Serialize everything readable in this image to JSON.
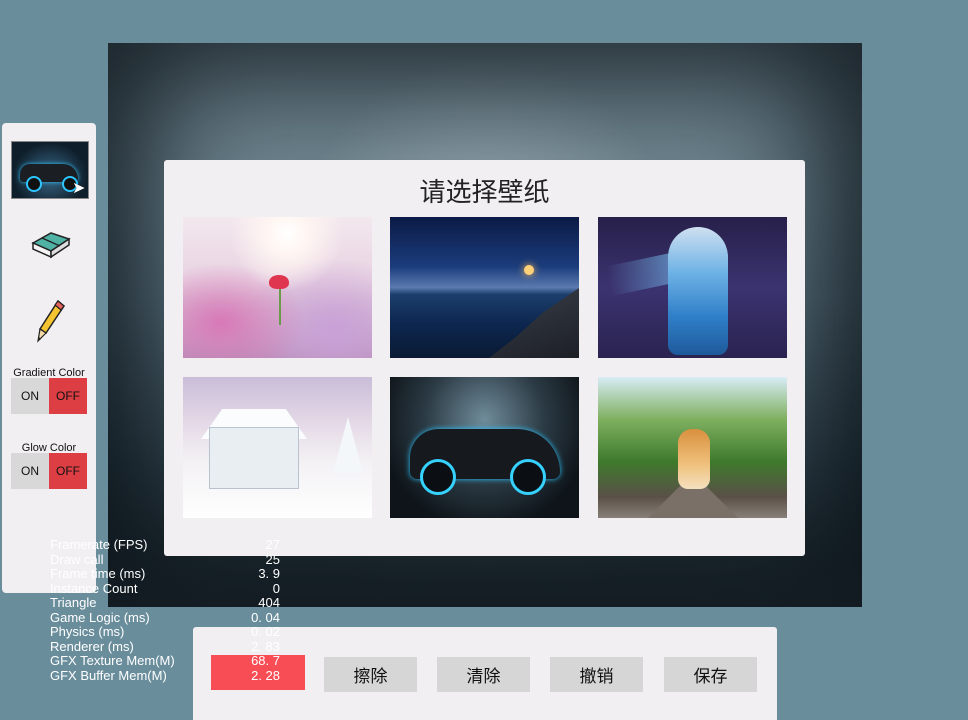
{
  "dialog": {
    "title": "请选择壁纸",
    "wallpapers": [
      {
        "name": "pink-flower"
      },
      {
        "name": "night-sea"
      },
      {
        "name": "blue-dancer"
      },
      {
        "name": "snow-cabin"
      },
      {
        "name": "neon-sports-car"
      },
      {
        "name": "corgi-railway"
      }
    ]
  },
  "tool_panel": {
    "tools": [
      "brush-thumbnail",
      "eraser",
      "pencil"
    ],
    "gradient_color": {
      "label": "Gradient Color",
      "on": "ON",
      "off": "OFF",
      "state": "OFF"
    },
    "glow_color": {
      "label": "Glow Color",
      "on": "ON",
      "off": "OFF",
      "state": "OFF"
    }
  },
  "stats": [
    {
      "label": "Framerate (FPS)",
      "value": "27"
    },
    {
      "label": "Draw call",
      "value": "25"
    },
    {
      "label": "Frame time (ms)",
      "value": "3. 9"
    },
    {
      "label": "Instance Count",
      "value": "0"
    },
    {
      "label": "Triangle",
      "value": "404"
    },
    {
      "label": "Game Logic (ms)",
      "value": "0. 04"
    },
    {
      "label": "Physics (ms)",
      "value": "0. 02"
    },
    {
      "label": "Renderer (ms)",
      "value": "2. 83"
    },
    {
      "label": "GFX Texture Mem(M)",
      "value": "68. 7"
    },
    {
      "label": "GFX Buffer Mem(M)",
      "value": "2. 28"
    }
  ],
  "toolbar": {
    "color": "#f84d55",
    "erase_label": "擦除",
    "clear_label": "清除",
    "undo_label": "撤销",
    "save_label": "保存"
  }
}
